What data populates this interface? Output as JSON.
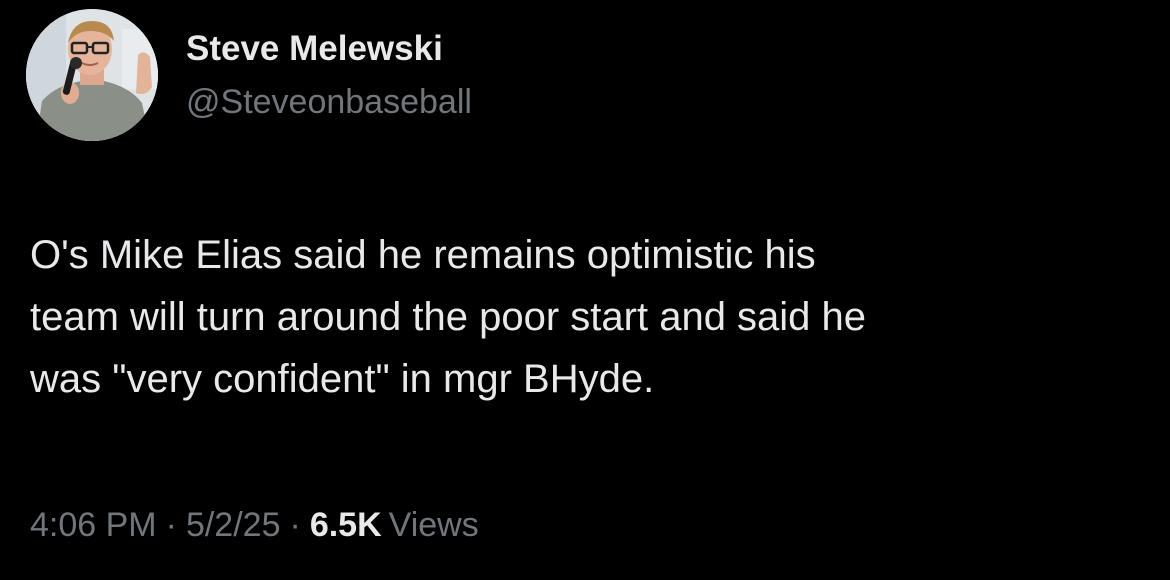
{
  "author": {
    "display_name": "Steve Melewski",
    "handle": "@Steveonbaseball",
    "avatar_icon": "avatar-photo-man-with-microphone"
  },
  "tweet": {
    "text": "O's Mike Elias said he remains optimistic his\nteam will turn around the poor start and said he\nwas \"very confident\" in mgr BHyde."
  },
  "meta": {
    "time": "4:06 PM",
    "separator": "·",
    "date": "5/2/25",
    "views_count": "6.5K",
    "views_label": "Views"
  },
  "colors": {
    "background": "#000000",
    "primary_text": "#e7e9ea",
    "secondary_text": "#71767b"
  }
}
